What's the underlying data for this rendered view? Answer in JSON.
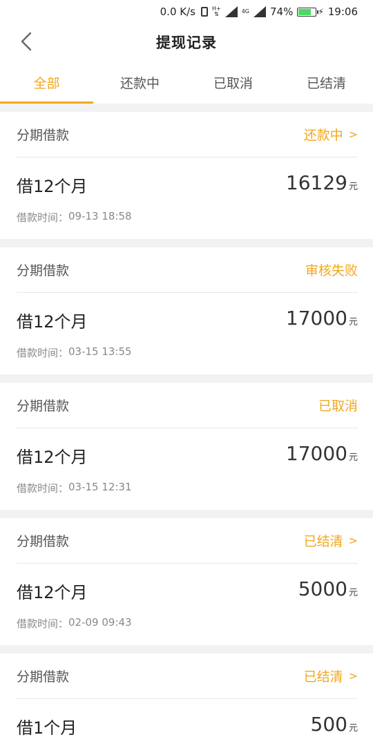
{
  "status_bar": {
    "speed": "0.0 K/s",
    "net_type": "H+",
    "net_4g": "4G",
    "battery": "74%",
    "time": "19:06"
  },
  "header": {
    "title": "提现记录",
    "back_icon": "chevron-left-icon"
  },
  "tabs": [
    {
      "label": "全部",
      "active": true
    },
    {
      "label": "还款中",
      "active": false
    },
    {
      "label": "已取消",
      "active": false
    },
    {
      "label": "已结清",
      "active": false
    }
  ],
  "colors": {
    "accent": "#f2a71b",
    "background": "#f2f2f4"
  },
  "records": [
    {
      "type": "分期借款",
      "status": "还款中",
      "has_arrow": true,
      "term": "借12个月",
      "amount": "16129",
      "unit": "元",
      "time_label": "借款时间：",
      "time": "09-13 18:58"
    },
    {
      "type": "分期借款",
      "status": "审核失败",
      "has_arrow": false,
      "term": "借12个月",
      "amount": "17000",
      "unit": "元",
      "time_label": "借款时间：",
      "time": "03-15 13:55"
    },
    {
      "type": "分期借款",
      "status": "已取消",
      "has_arrow": false,
      "term": "借12个月",
      "amount": "17000",
      "unit": "元",
      "time_label": "借款时间：",
      "time": "03-15 12:31"
    },
    {
      "type": "分期借款",
      "status": "已结清",
      "has_arrow": true,
      "term": "借12个月",
      "amount": "5000",
      "unit": "元",
      "time_label": "借款时间：",
      "time": "02-09 09:43"
    },
    {
      "type": "分期借款",
      "status": "已结清",
      "has_arrow": true,
      "term": "借1个月",
      "amount": "500",
      "unit": "元",
      "time_label": "",
      "time": ""
    }
  ],
  "arrow_glyph": ">"
}
